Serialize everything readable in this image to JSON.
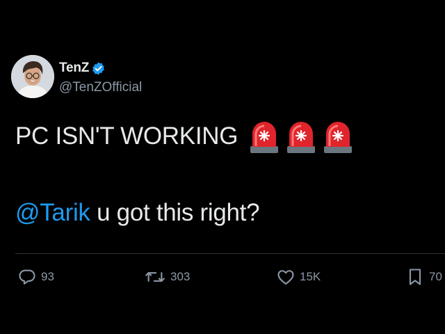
{
  "author": {
    "display_name": "TenZ",
    "handle": "@TenZOfficial",
    "verified": true
  },
  "tweet": {
    "line1": "PC ISN'T WORKING",
    "emoji": [
      "police-car-light",
      "police-car-light",
      "police-car-light"
    ],
    "mention": "@Tarik",
    "line2_rest": " u got this right?"
  },
  "metrics": {
    "replies": "93",
    "retweets": "303",
    "likes": "15K",
    "bookmarks": "70"
  },
  "icons": {
    "reply": "reply-icon",
    "retweet": "retweet-icon",
    "like": "heart-icon",
    "bookmark": "bookmark-icon",
    "verified": "verified-badge-icon"
  },
  "colors": {
    "background": "#000000",
    "text": "#e7e9ea",
    "secondary": "#8b98a5",
    "link": "#1d9bf0",
    "divider": "#2f3336"
  }
}
